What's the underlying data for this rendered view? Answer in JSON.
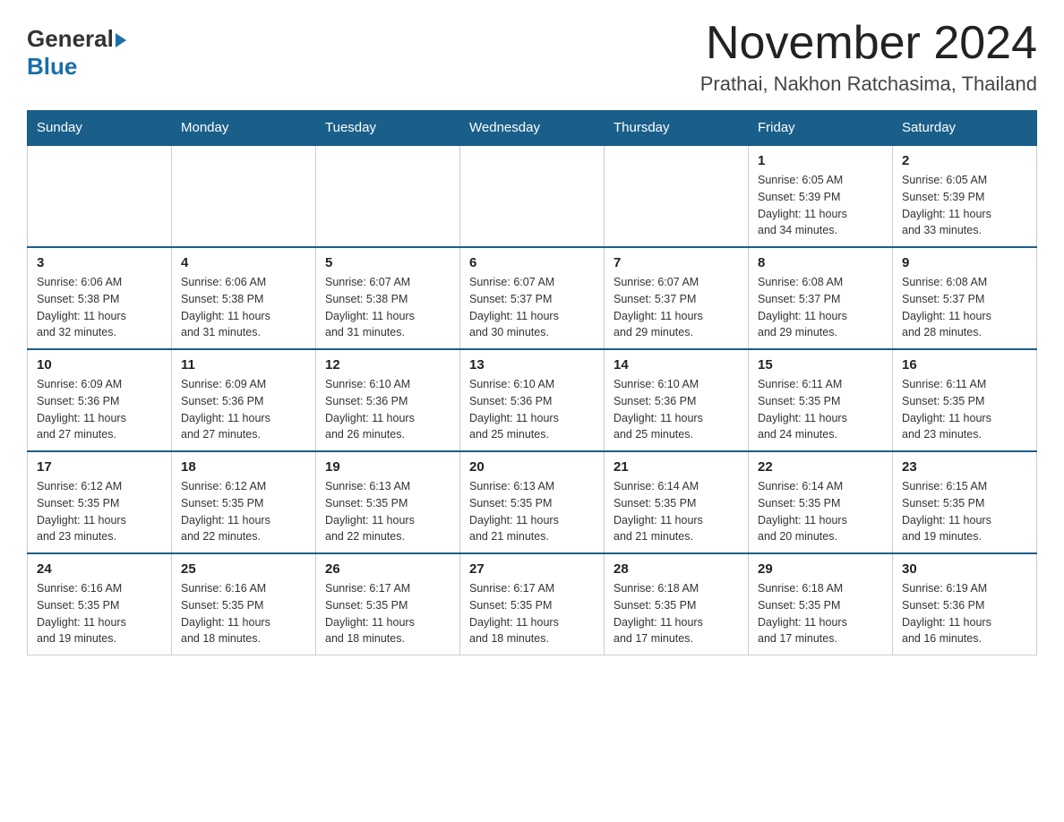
{
  "header": {
    "logo_general": "General",
    "logo_blue": "Blue",
    "month_title": "November 2024",
    "location": "Prathai, Nakhon Ratchasima, Thailand"
  },
  "days_of_week": [
    "Sunday",
    "Monday",
    "Tuesday",
    "Wednesday",
    "Thursday",
    "Friday",
    "Saturday"
  ],
  "weeks": [
    [
      {
        "day": "",
        "info": ""
      },
      {
        "day": "",
        "info": ""
      },
      {
        "day": "",
        "info": ""
      },
      {
        "day": "",
        "info": ""
      },
      {
        "day": "",
        "info": ""
      },
      {
        "day": "1",
        "info": "Sunrise: 6:05 AM\nSunset: 5:39 PM\nDaylight: 11 hours\nand 34 minutes."
      },
      {
        "day": "2",
        "info": "Sunrise: 6:05 AM\nSunset: 5:39 PM\nDaylight: 11 hours\nand 33 minutes."
      }
    ],
    [
      {
        "day": "3",
        "info": "Sunrise: 6:06 AM\nSunset: 5:38 PM\nDaylight: 11 hours\nand 32 minutes."
      },
      {
        "day": "4",
        "info": "Sunrise: 6:06 AM\nSunset: 5:38 PM\nDaylight: 11 hours\nand 31 minutes."
      },
      {
        "day": "5",
        "info": "Sunrise: 6:07 AM\nSunset: 5:38 PM\nDaylight: 11 hours\nand 31 minutes."
      },
      {
        "day": "6",
        "info": "Sunrise: 6:07 AM\nSunset: 5:37 PM\nDaylight: 11 hours\nand 30 minutes."
      },
      {
        "day": "7",
        "info": "Sunrise: 6:07 AM\nSunset: 5:37 PM\nDaylight: 11 hours\nand 29 minutes."
      },
      {
        "day": "8",
        "info": "Sunrise: 6:08 AM\nSunset: 5:37 PM\nDaylight: 11 hours\nand 29 minutes."
      },
      {
        "day": "9",
        "info": "Sunrise: 6:08 AM\nSunset: 5:37 PM\nDaylight: 11 hours\nand 28 minutes."
      }
    ],
    [
      {
        "day": "10",
        "info": "Sunrise: 6:09 AM\nSunset: 5:36 PM\nDaylight: 11 hours\nand 27 minutes."
      },
      {
        "day": "11",
        "info": "Sunrise: 6:09 AM\nSunset: 5:36 PM\nDaylight: 11 hours\nand 27 minutes."
      },
      {
        "day": "12",
        "info": "Sunrise: 6:10 AM\nSunset: 5:36 PM\nDaylight: 11 hours\nand 26 minutes."
      },
      {
        "day": "13",
        "info": "Sunrise: 6:10 AM\nSunset: 5:36 PM\nDaylight: 11 hours\nand 25 minutes."
      },
      {
        "day": "14",
        "info": "Sunrise: 6:10 AM\nSunset: 5:36 PM\nDaylight: 11 hours\nand 25 minutes."
      },
      {
        "day": "15",
        "info": "Sunrise: 6:11 AM\nSunset: 5:35 PM\nDaylight: 11 hours\nand 24 minutes."
      },
      {
        "day": "16",
        "info": "Sunrise: 6:11 AM\nSunset: 5:35 PM\nDaylight: 11 hours\nand 23 minutes."
      }
    ],
    [
      {
        "day": "17",
        "info": "Sunrise: 6:12 AM\nSunset: 5:35 PM\nDaylight: 11 hours\nand 23 minutes."
      },
      {
        "day": "18",
        "info": "Sunrise: 6:12 AM\nSunset: 5:35 PM\nDaylight: 11 hours\nand 22 minutes."
      },
      {
        "day": "19",
        "info": "Sunrise: 6:13 AM\nSunset: 5:35 PM\nDaylight: 11 hours\nand 22 minutes."
      },
      {
        "day": "20",
        "info": "Sunrise: 6:13 AM\nSunset: 5:35 PM\nDaylight: 11 hours\nand 21 minutes."
      },
      {
        "day": "21",
        "info": "Sunrise: 6:14 AM\nSunset: 5:35 PM\nDaylight: 11 hours\nand 21 minutes."
      },
      {
        "day": "22",
        "info": "Sunrise: 6:14 AM\nSunset: 5:35 PM\nDaylight: 11 hours\nand 20 minutes."
      },
      {
        "day": "23",
        "info": "Sunrise: 6:15 AM\nSunset: 5:35 PM\nDaylight: 11 hours\nand 19 minutes."
      }
    ],
    [
      {
        "day": "24",
        "info": "Sunrise: 6:16 AM\nSunset: 5:35 PM\nDaylight: 11 hours\nand 19 minutes."
      },
      {
        "day": "25",
        "info": "Sunrise: 6:16 AM\nSunset: 5:35 PM\nDaylight: 11 hours\nand 18 minutes."
      },
      {
        "day": "26",
        "info": "Sunrise: 6:17 AM\nSunset: 5:35 PM\nDaylight: 11 hours\nand 18 minutes."
      },
      {
        "day": "27",
        "info": "Sunrise: 6:17 AM\nSunset: 5:35 PM\nDaylight: 11 hours\nand 18 minutes."
      },
      {
        "day": "28",
        "info": "Sunrise: 6:18 AM\nSunset: 5:35 PM\nDaylight: 11 hours\nand 17 minutes."
      },
      {
        "day": "29",
        "info": "Sunrise: 6:18 AM\nSunset: 5:35 PM\nDaylight: 11 hours\nand 17 minutes."
      },
      {
        "day": "30",
        "info": "Sunrise: 6:19 AM\nSunset: 5:36 PM\nDaylight: 11 hours\nand 16 minutes."
      }
    ]
  ]
}
